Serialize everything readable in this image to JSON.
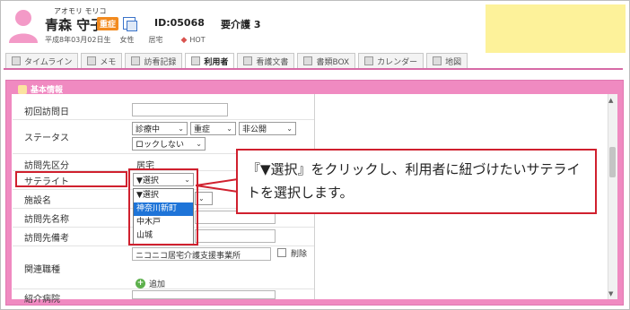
{
  "header": {
    "furigana": "アオモリ モリコ",
    "name": "青森 守子",
    "badge": "重症",
    "patient_id": "ID:05068",
    "care_level": "要介護 3",
    "birth": "平成8年03月02日生",
    "gender": "女性",
    "residence": "居宅",
    "tag": "HOT"
  },
  "tabs": [
    {
      "label": "タイムライン",
      "icon": "timeline-icon"
    },
    {
      "label": "メモ",
      "icon": "pencil-icon"
    },
    {
      "label": "訪看記録",
      "icon": "record-icon"
    },
    {
      "label": "利用者",
      "icon": "user-card-icon",
      "active": true
    },
    {
      "label": "看護文書",
      "icon": "document-icon"
    },
    {
      "label": "書類BOX",
      "icon": "box-icon"
    },
    {
      "label": "カレンダー",
      "icon": "calendar-icon"
    },
    {
      "label": "地図",
      "icon": "map-icon"
    }
  ],
  "panel": {
    "title": "基本情報"
  },
  "form": {
    "first_visit_label": "初回訪問日",
    "status_label": "ステータス",
    "status_values": {
      "treatment": "診療中",
      "severity": "重症",
      "visibility": "非公開",
      "lock": "ロックしない"
    },
    "visit_category_label": "訪問先区分",
    "visit_category_value": "居宅",
    "satellite_label": "サテライト",
    "satellite_value": "▼選択",
    "facility_label": "施設名",
    "visit_name_label": "訪問先名称",
    "visit_note_label": "訪問先備考",
    "related_label": "関連職種",
    "related_value": "ニコニコ居宅介護支援事業所",
    "delete_label": "削除",
    "add_label": "追加",
    "hospital_label": "紹介病院"
  },
  "dropdown": {
    "options": [
      "▼選択",
      "神奈川新町",
      "中木戸",
      "山城"
    ],
    "highlighted_index": 1
  },
  "callout": {
    "text": "『▼選択』をクリックし、利用者に紐づけたいサテライトを選択します。"
  },
  "colors": {
    "panel_pink": "#f08ac1",
    "highlight_red": "#d0202e",
    "selection_blue": "#1e74d8",
    "badge_orange": "#f28a1f",
    "note_yellow": "#fdf29a"
  }
}
